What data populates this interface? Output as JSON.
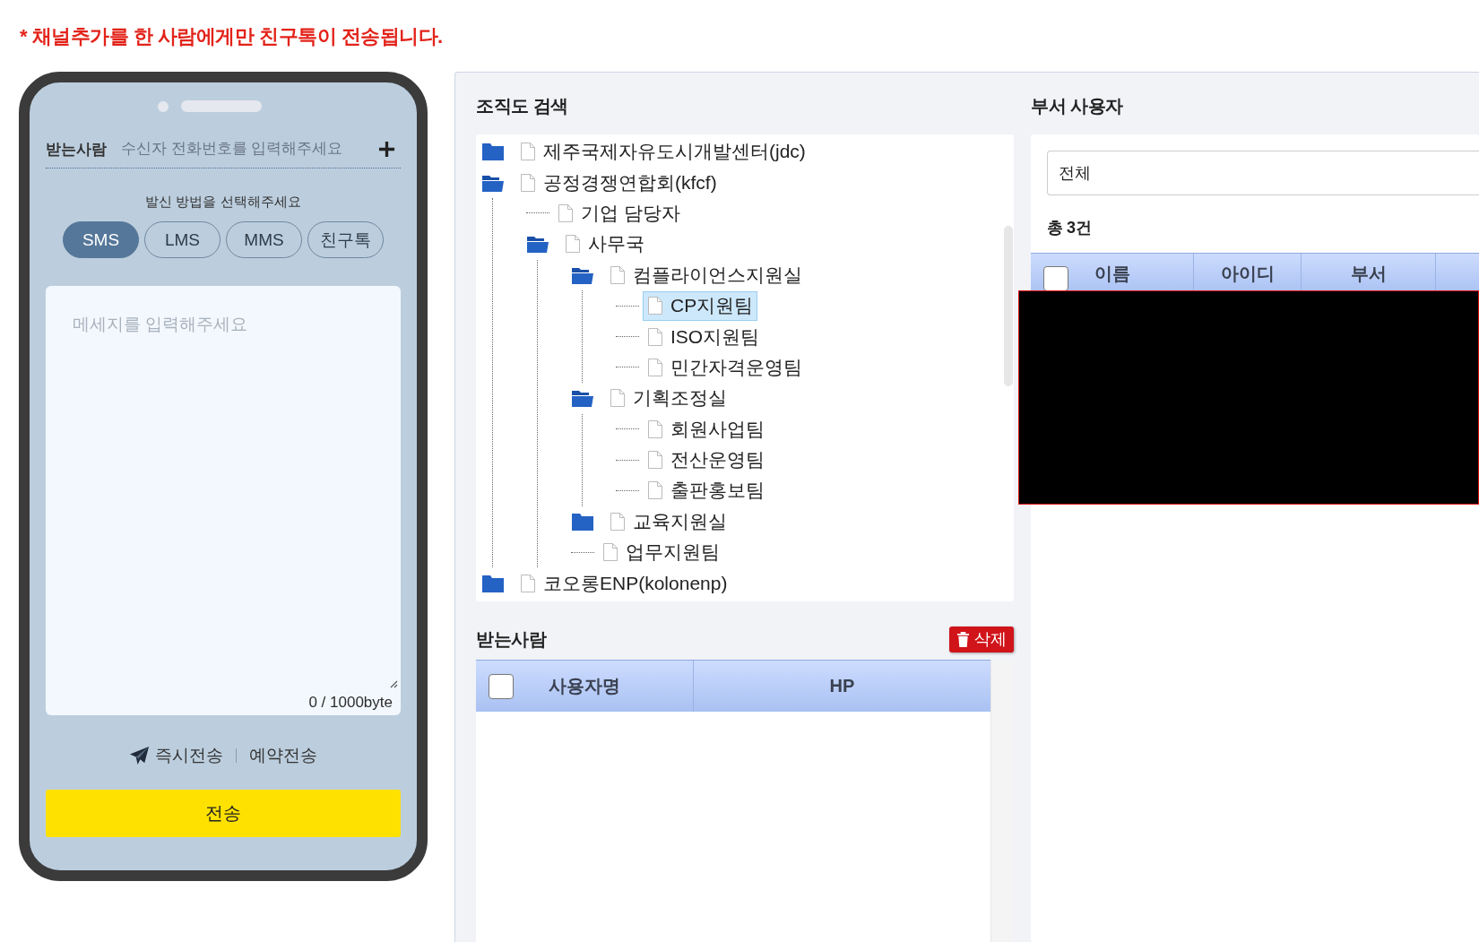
{
  "notice": "* 채널추가를 한 사람에게만 친구톡이 전송됩니다.",
  "phone": {
    "recipient_label": "받는사람",
    "recipient_placeholder": "수신자 전화번호를 입력해주세요",
    "method_prompt": "발신 방법을 선택해주세요",
    "methods": [
      {
        "label": "SMS",
        "selected": true
      },
      {
        "label": "LMS",
        "selected": false
      },
      {
        "label": "MMS",
        "selected": false
      },
      {
        "label": "친구톡",
        "selected": false
      }
    ],
    "message_placeholder": "메세지를 입력해주세요",
    "byte_counter": "0 / 1000byte",
    "send_modes": [
      {
        "label": "즉시전송",
        "selected": true
      },
      {
        "label": "예약전송",
        "selected": false
      }
    ],
    "send_button": "전송"
  },
  "org_tree": {
    "title": "조직도 검색",
    "items": [
      {
        "kind": "folder",
        "label": "제주국제자유도시개발센터(jdc)",
        "expanded": false,
        "selected": false
      },
      {
        "kind": "folder",
        "label": "공정경쟁연합회(kfcf)",
        "expanded": true,
        "selected": false,
        "children": [
          {
            "label": "기업 담당자",
            "selected": false
          },
          {
            "kind": "folder",
            "label": "사무국",
            "expanded": true,
            "selected": false,
            "children": [
              {
                "kind": "folder",
                "label": "컴플라이언스지원실",
                "expanded": true,
                "selected": false,
                "children": [
                  {
                    "label": "CP지원팀",
                    "selected": true
                  },
                  {
                    "label": "ISO지원팀",
                    "selected": false
                  },
                  {
                    "label": "민간자격운영팀",
                    "selected": false
                  }
                ]
              },
              {
                "kind": "folder",
                "label": "기획조정실",
                "expanded": true,
                "selected": false,
                "children": [
                  {
                    "label": "회원사업팀",
                    "selected": false
                  },
                  {
                    "label": "전산운영팀",
                    "selected": false
                  },
                  {
                    "label": "출판홍보팀",
                    "selected": false
                  }
                ]
              },
              {
                "kind": "folder",
                "label": "교육지원실",
                "expanded": false,
                "selected": false
              },
              {
                "label": "업무지원팀",
                "selected": false
              }
            ]
          }
        ]
      },
      {
        "kind": "folder",
        "label": "코오롱ENP(kolonenp)",
        "expanded": false,
        "selected": false
      }
    ]
  },
  "dept_users": {
    "title": "부서 사용자",
    "filter_value": "전체",
    "total": "총 3건",
    "select_all_checked": false,
    "columns": [
      "이름",
      "아이디",
      "부서"
    ]
  },
  "recipients": {
    "title": "받는사람",
    "delete_button": "삭제",
    "select_all_checked": false,
    "columns": [
      "사용자명",
      "HP"
    ]
  }
}
